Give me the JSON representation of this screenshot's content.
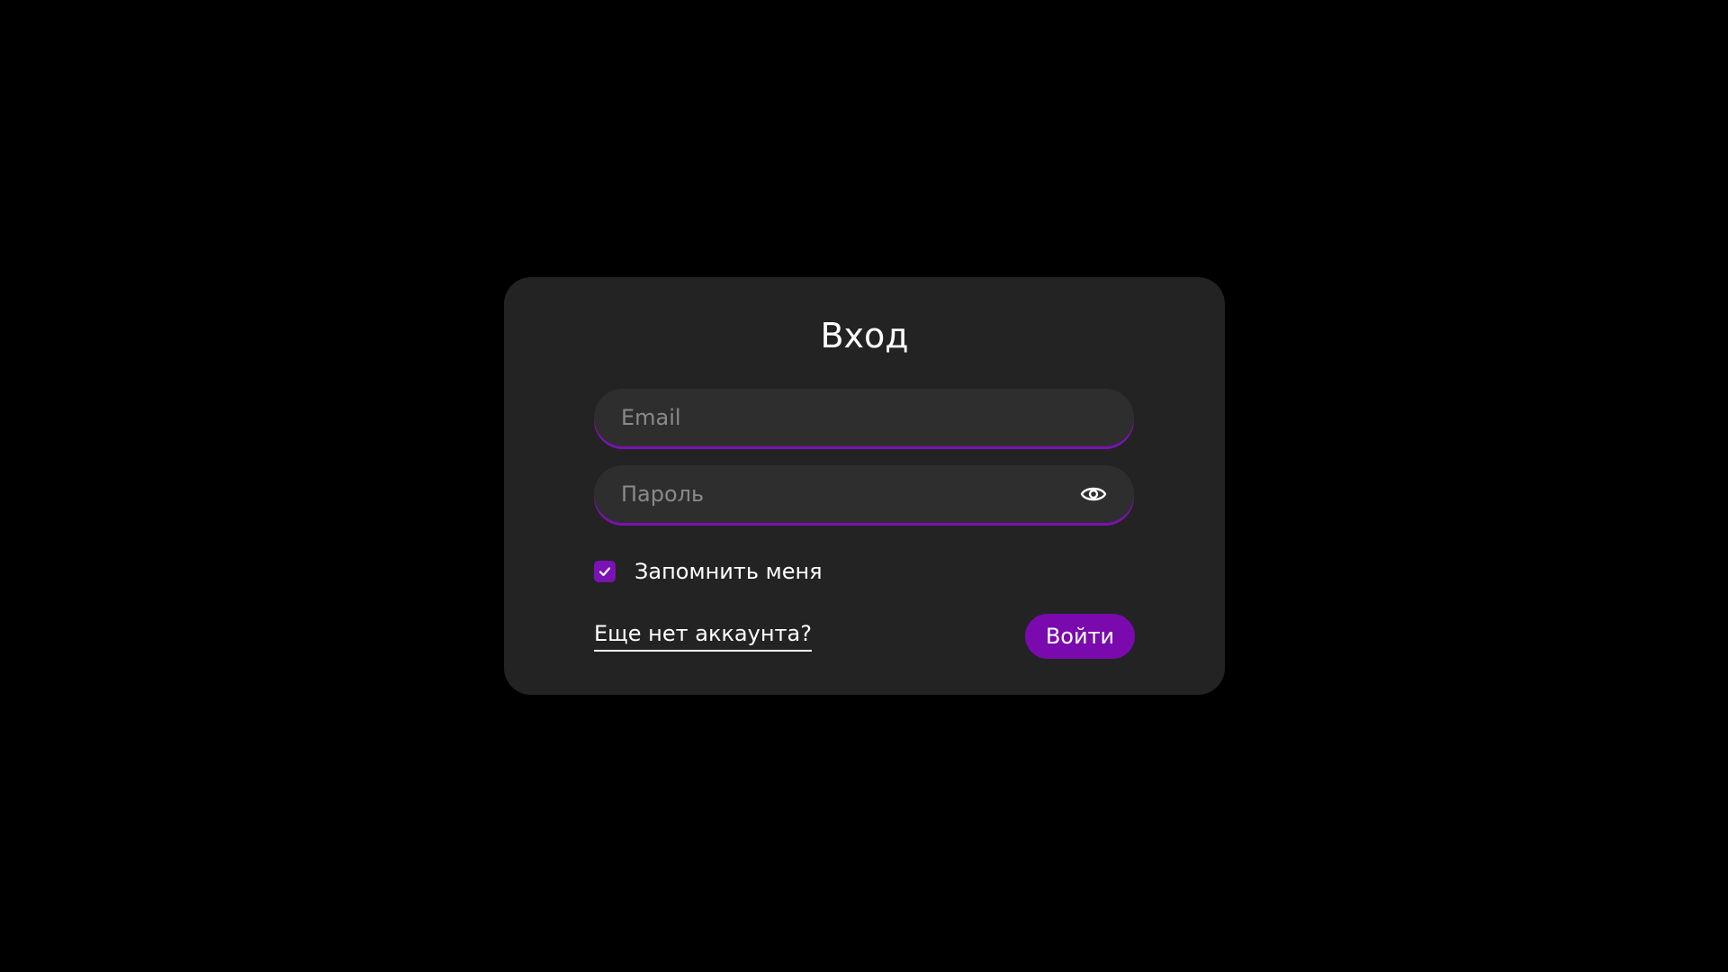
{
  "form": {
    "title": "Вход",
    "email": {
      "value": "",
      "placeholder": "Email"
    },
    "password": {
      "value": "",
      "placeholder": "Пароль",
      "toggle_icon": "eye-icon"
    },
    "remember": {
      "label": "Запомнить меня",
      "checked": true,
      "icon": "checkmark-icon"
    },
    "signup_link": "Еще нет аккаунта?",
    "submit_label": "Войти"
  },
  "colors": {
    "background": "#000000",
    "card": "#232323",
    "field": "#2e2e2e",
    "accent": "#7a12b4",
    "text": "#ffffff",
    "placeholder": "#8a8a8a"
  }
}
